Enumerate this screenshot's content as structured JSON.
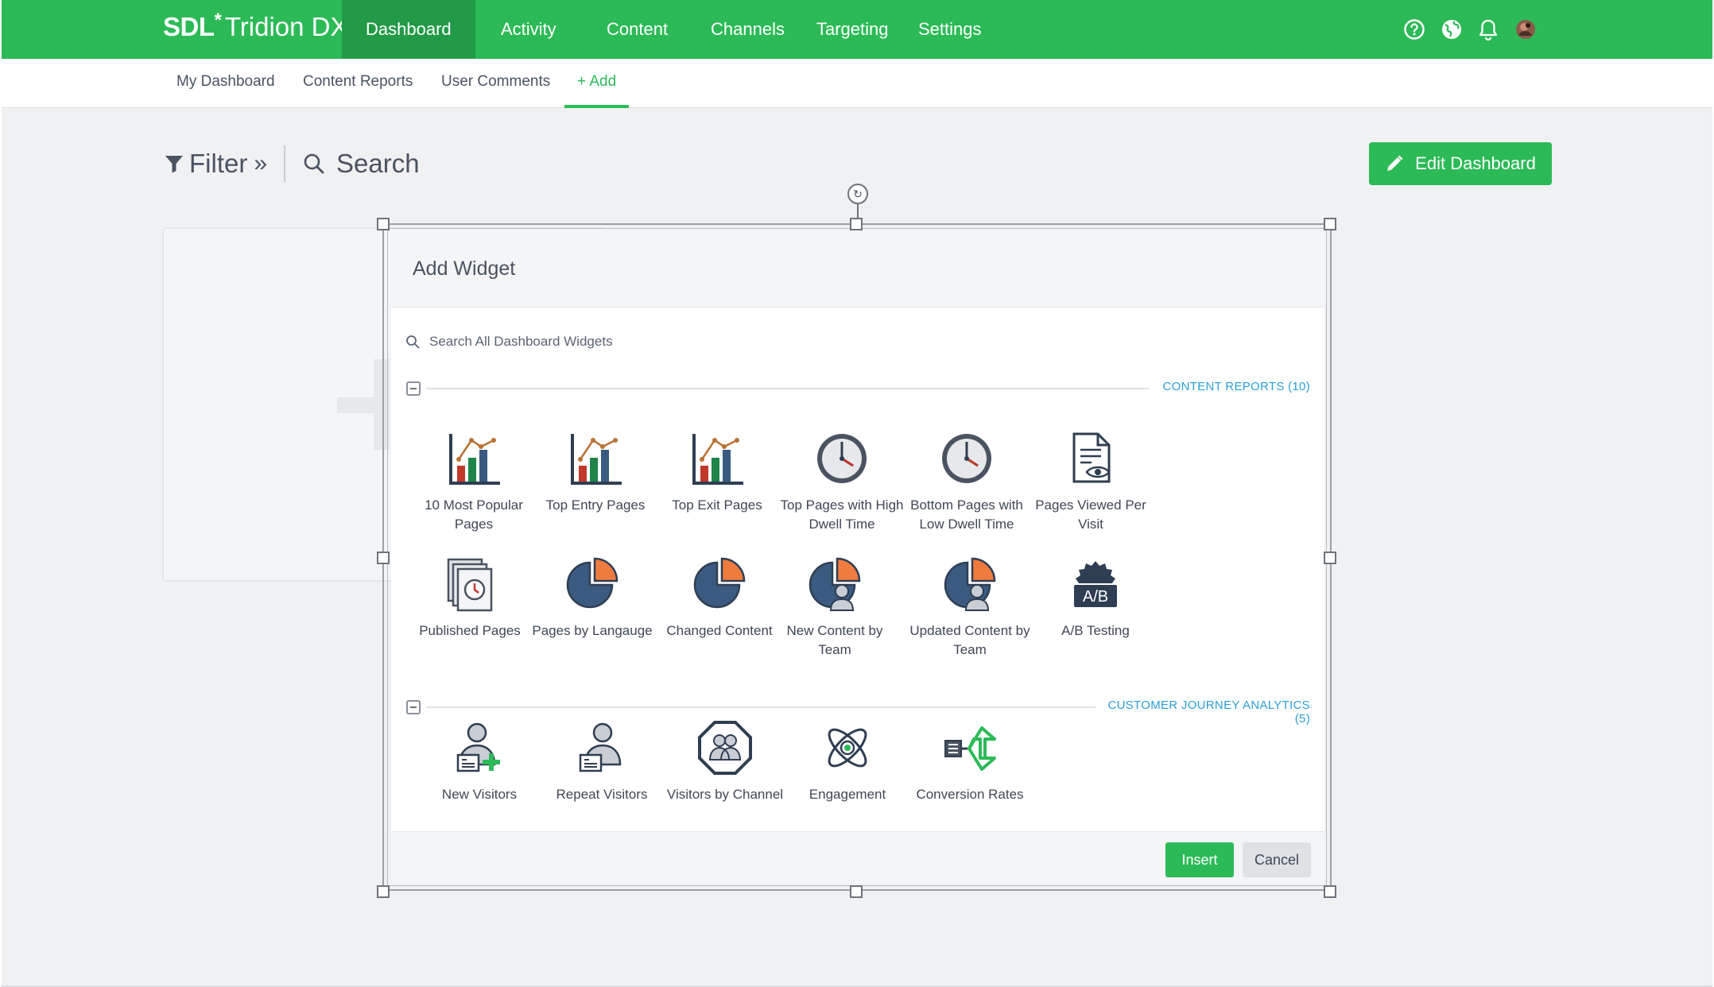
{
  "header": {
    "brand": "SDL",
    "brand_mark": "*",
    "product": "Tridion DX",
    "nav": [
      {
        "label": "Dashboard",
        "active": true
      },
      {
        "label": "Activity"
      },
      {
        "label": "Content"
      },
      {
        "label": "Channels"
      },
      {
        "label": "Targeting"
      },
      {
        "label": "Settings"
      }
    ],
    "icons": [
      "help-icon",
      "globe-icon",
      "bell-icon",
      "user-avatar"
    ],
    "accent_color": "#2cba57"
  },
  "subnav": {
    "items": [
      "My Dashboard",
      "Content Reports",
      "User Comments",
      "+ Add"
    ],
    "active": "+ Add"
  },
  "toolbar": {
    "filter_label": "Filter",
    "filter_chevron": "»",
    "search_label": "Search",
    "edit_button": "Edit Dashboard"
  },
  "dialog": {
    "title": "Add Widget",
    "search_placeholder": "Search All Dashboard Widgets",
    "sections": [
      {
        "title": "CONTENT REPORTS (10)",
        "widgets": [
          {
            "label": "10 Most Popular Pages",
            "icon": "bar-chart-icon"
          },
          {
            "label": "Top Entry Pages",
            "icon": "bar-chart-icon"
          },
          {
            "label": "Top Exit Pages",
            "icon": "bar-chart-icon"
          },
          {
            "label": "Top Pages with High Dwell Time",
            "icon": "clock-icon"
          },
          {
            "label": "Bottom Pages with Low Dwell Time",
            "icon": "clock-icon"
          },
          {
            "label": "Pages Viewed Per Visit",
            "icon": "document-eye-icon"
          },
          {
            "label": "Published Pages",
            "icon": "stacked-pages-clock-icon"
          },
          {
            "label": "Pages by Langauge",
            "icon": "pie-chart-icon"
          },
          {
            "label": "Changed Content",
            "icon": "pie-chart-icon"
          },
          {
            "label": "New Content by Team",
            "icon": "pie-chart-user-icon"
          },
          {
            "label": "Updated Content by Team",
            "icon": "pie-chart-user-icon"
          },
          {
            "label": "A/B Testing",
            "icon": "gear-ab-icon",
            "icon_text": "A/B"
          }
        ]
      },
      {
        "title": "CUSTOMER JOURNEY ANALYTICS (5)",
        "widgets": [
          {
            "label": "New Visitors",
            "icon": "user-plus-icon"
          },
          {
            "label": "Repeat Visitors",
            "icon": "user-card-icon"
          },
          {
            "label": "Visitors by Channel",
            "icon": "users-octagon-icon"
          },
          {
            "label": "Engagement",
            "icon": "atom-icon"
          },
          {
            "label": "Conversion Rates",
            "icon": "conversion-arrows-icon"
          }
        ]
      }
    ],
    "insert_label": "Insert",
    "cancel_label": "Cancel"
  }
}
